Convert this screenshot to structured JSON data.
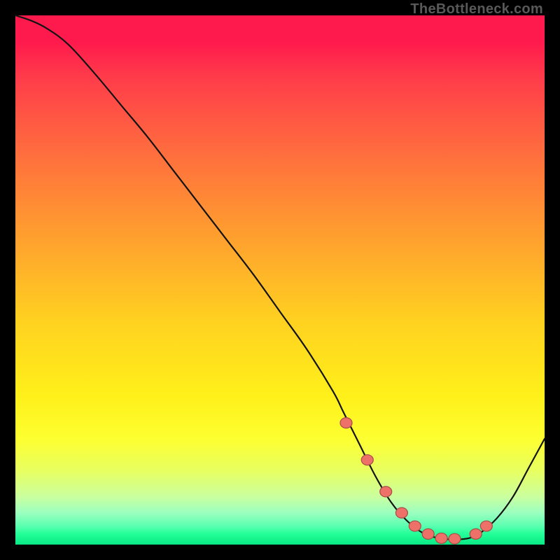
{
  "attribution": "TheBottleneck.com",
  "chart_data": {
    "type": "line",
    "title": "",
    "xlabel": "",
    "ylabel": "",
    "xlim": [
      0,
      100
    ],
    "ylim": [
      0,
      100
    ],
    "series": [
      {
        "name": "curve",
        "x": [
          0,
          3,
          6,
          10,
          15,
          20,
          25,
          30,
          35,
          40,
          45,
          50,
          55,
          60,
          62,
          65,
          68,
          71,
          74,
          77,
          80,
          82,
          84,
          86,
          88,
          91,
          94,
          97,
          100
        ],
        "y": [
          100,
          99,
          97.5,
          94.5,
          89,
          83,
          77,
          70.5,
          64,
          57.5,
          51,
          44,
          37,
          29,
          25,
          19,
          13,
          8,
          4.5,
          2.2,
          1.2,
          1.0,
          1.0,
          1.3,
          2.3,
          5,
          9,
          14.5,
          20
        ]
      }
    ],
    "markers": {
      "name": "highlight-points",
      "x": [
        62.5,
        66.5,
        70,
        73,
        75.5,
        78,
        80.5,
        83,
        87,
        89
      ],
      "y": [
        23,
        16,
        10,
        6,
        3.5,
        2.0,
        1.2,
        1.1,
        2.0,
        3.5
      ]
    },
    "colors": {
      "curve": "#141414",
      "marker_fill": "#ed7168",
      "marker_stroke": "#a84d46"
    }
  }
}
